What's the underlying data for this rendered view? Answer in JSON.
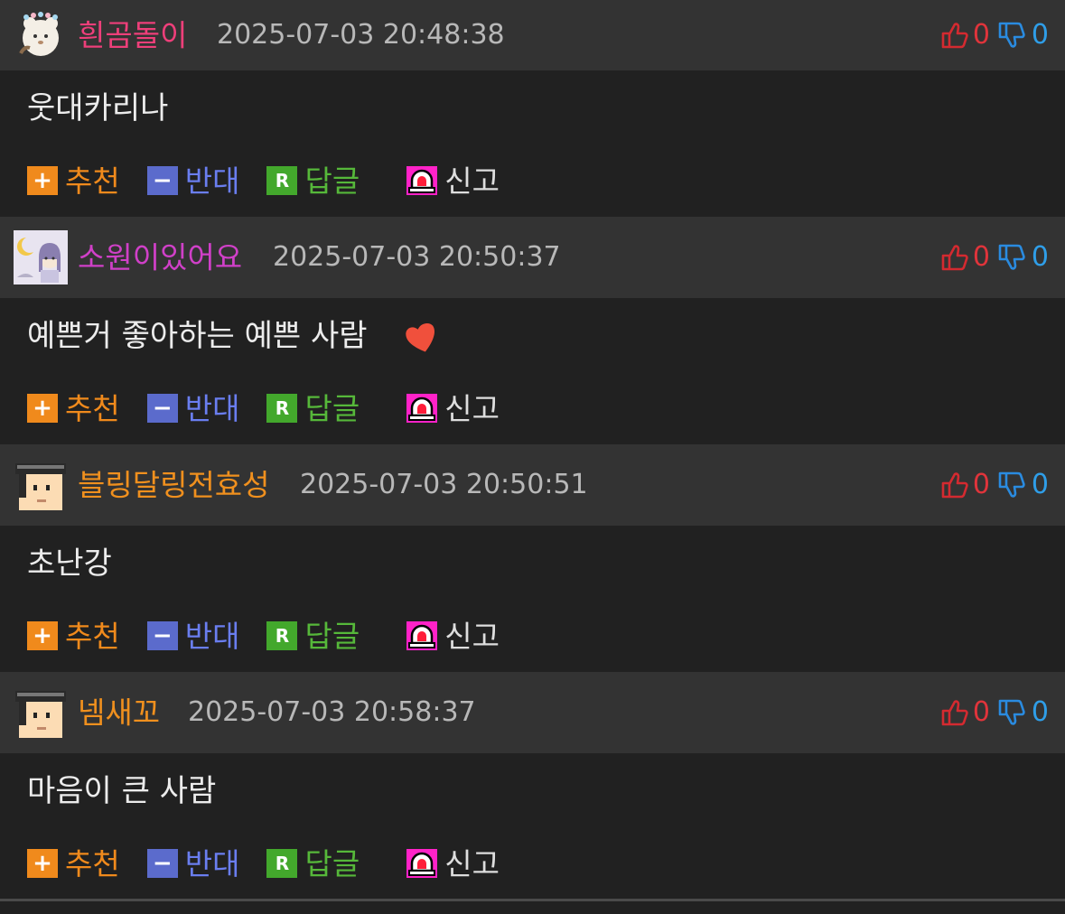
{
  "colors": {
    "nick_pink": "#ee3f7a",
    "nick_magenta": "#d040c8",
    "nick_orange": "#f0901e"
  },
  "actions": {
    "recommend": "추천",
    "oppose": "반대",
    "reply": "답글",
    "report": "신고",
    "reply_icon_letter": "R"
  },
  "comments": [
    {
      "nickname": "흰곰돌이",
      "datetime": "2025-07-03 20:48:38",
      "text": "웃대카리나",
      "up": "0",
      "down": "0"
    },
    {
      "nickname": "소원이있어요",
      "datetime": "2025-07-03 20:50:37",
      "text": "예쁜거 좋아하는 예쁜 사람",
      "up": "0",
      "down": "0"
    },
    {
      "nickname": "블링달링전효성",
      "datetime": "2025-07-03 20:50:51",
      "text": "초난강",
      "up": "0",
      "down": "0"
    },
    {
      "nickname": "넴새꼬",
      "datetime": "2025-07-03 20:58:37",
      "text": "마음이 큰 사람",
      "up": "0",
      "down": "0"
    }
  ]
}
